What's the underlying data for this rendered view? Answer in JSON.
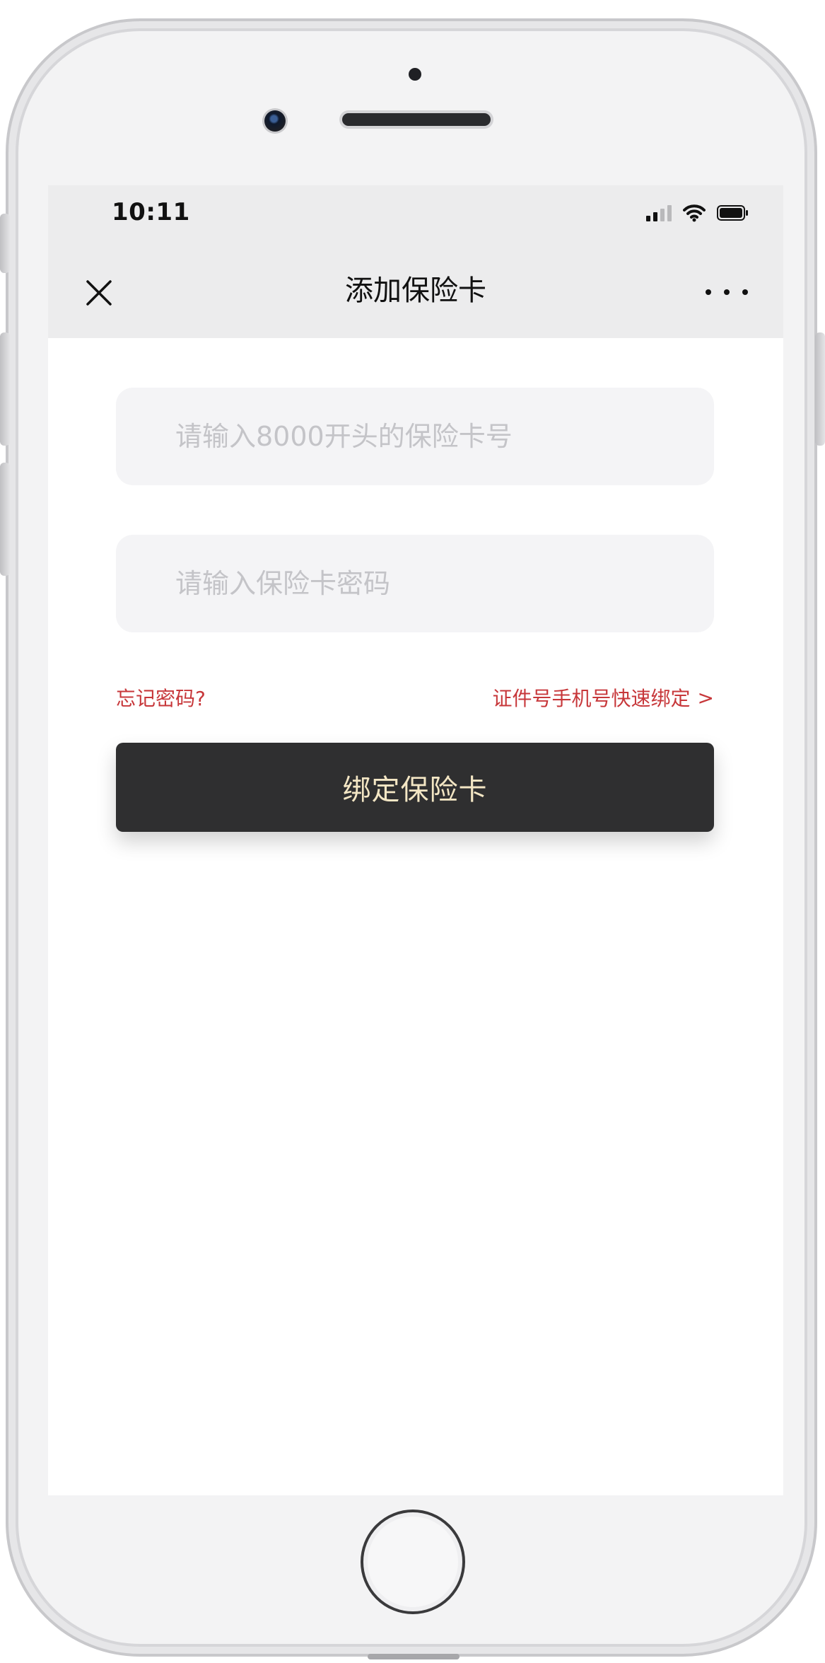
{
  "status_bar": {
    "time": "10:11",
    "signal_icon": "cellular-signal-icon",
    "wifi_icon": "wifi-icon",
    "battery_icon": "battery-icon"
  },
  "nav": {
    "title": "添加保险卡",
    "close_icon": "close-icon",
    "more_icon": "more-icon"
  },
  "form": {
    "card_number": {
      "placeholder": "请输入8000开头的保险卡号",
      "value": ""
    },
    "password": {
      "placeholder": "请输入保险卡密码",
      "value": ""
    },
    "forgot_password_label": "忘记密码?",
    "quick_bind_label": "证件号手机号快速绑定",
    "quick_bind_chevron": ">",
    "submit_label": "绑定保险卡"
  },
  "colors": {
    "accent_red": "#c7373a",
    "button_bg": "#2f2f30",
    "button_text": "#f3e6c4",
    "nav_bg": "#ececed",
    "field_bg": "#f4f4f6"
  }
}
